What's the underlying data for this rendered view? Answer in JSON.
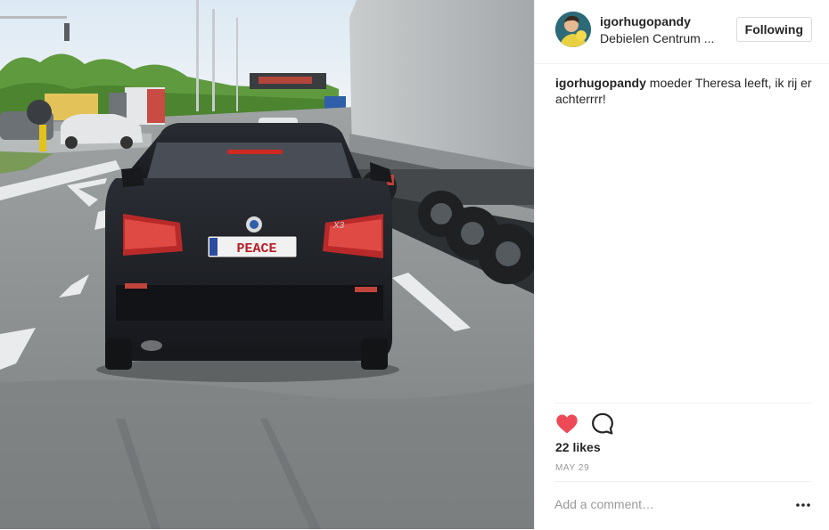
{
  "post": {
    "username": "igorhugopandy",
    "location": "Debielen Centrum ...",
    "follow_label": "Following",
    "caption_user": "igorhugopandy",
    "caption_text": " moeder Theresa leeft, ik rij er achterrrr!",
    "likes": "22 likes",
    "date": "MAY 29",
    "comment_placeholder": "Add a comment…",
    "license_plate": "PEACE",
    "car_badge": "X3"
  },
  "icons": {
    "like": "heart-icon",
    "comment": "comment-icon",
    "more": "more-options-icon"
  },
  "colors": {
    "heart": "#ed4956",
    "border": "#efefef",
    "muted": "#999999",
    "text": "#262626"
  }
}
